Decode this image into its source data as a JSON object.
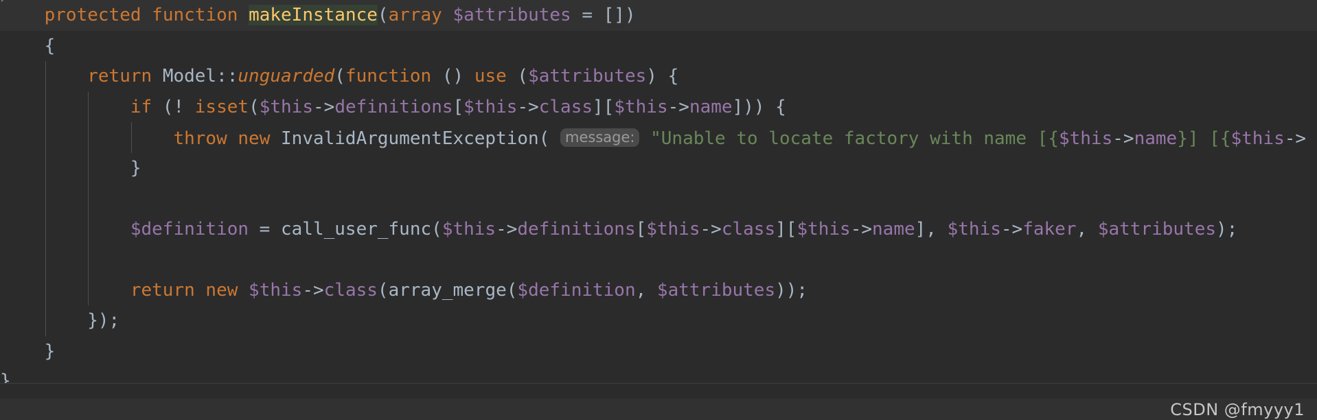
{
  "window": {
    "app": "code-editor",
    "theme": "darcula",
    "language": "PHP"
  },
  "colors": {
    "background": "#2b2b2b",
    "caret_line_background": "#323232",
    "default_text": "#a9b7c6",
    "keyword": "#cc7832",
    "function_declaration": "#ffc66d",
    "variable": "#9876aa",
    "string": "#6a8759",
    "inlay_hint_background": "#4a4a4a",
    "inlay_hint_text": "#9a9a9a",
    "identifier_highlight": "#344134",
    "indent_guide": "#4f5052",
    "watermark_text": "#c7c7c7"
  },
  "editor": {
    "fragment_above": "/",
    "fragment_below": "}",
    "lines": [
      {
        "id": "line-signature",
        "caret": true,
        "indent": 1,
        "tokens": [
          {
            "t": "    ",
            "c": "plain"
          },
          {
            "t": "protected",
            "c": "kw"
          },
          {
            "t": " ",
            "c": "plain"
          },
          {
            "t": "function",
            "c": "kw"
          },
          {
            "t": " ",
            "c": "plain"
          },
          {
            "t": "makeInstance",
            "c": "fn",
            "hl": true
          },
          {
            "t": "(",
            "c": "punc"
          },
          {
            "t": "array",
            "c": "kw"
          },
          {
            "t": " ",
            "c": "plain"
          },
          {
            "t": "$attributes",
            "c": "var"
          },
          {
            "t": " = [])",
            "c": "punc"
          }
        ]
      },
      {
        "id": "line-open-brace",
        "caret": false,
        "indent": 1,
        "tokens": [
          {
            "t": "    {",
            "c": "punc"
          }
        ]
      },
      {
        "id": "line-return-unguarded",
        "caret": false,
        "indent": 2,
        "tokens": [
          {
            "t": "        ",
            "c": "plain"
          },
          {
            "t": "return",
            "c": "kw"
          },
          {
            "t": " ",
            "c": "plain"
          },
          {
            "t": "Model",
            "c": "cls"
          },
          {
            "t": "::",
            "c": "punc"
          },
          {
            "t": "unguarded",
            "c": "kw-i"
          },
          {
            "t": "(",
            "c": "punc"
          },
          {
            "t": "function",
            "c": "kw"
          },
          {
            "t": " () ",
            "c": "punc"
          },
          {
            "t": "use",
            "c": "kw"
          },
          {
            "t": " (",
            "c": "punc"
          },
          {
            "t": "$attributes",
            "c": "var"
          },
          {
            "t": ") {",
            "c": "punc"
          }
        ]
      },
      {
        "id": "line-if-isset",
        "caret": false,
        "indent": 3,
        "tokens": [
          {
            "t": "            ",
            "c": "plain"
          },
          {
            "t": "if",
            "c": "kw"
          },
          {
            "t": " (! ",
            "c": "punc"
          },
          {
            "t": "isset",
            "c": "kw"
          },
          {
            "t": "(",
            "c": "punc"
          },
          {
            "t": "$this",
            "c": "var"
          },
          {
            "t": "->",
            "c": "punc"
          },
          {
            "t": "definitions",
            "c": "var"
          },
          {
            "t": "[",
            "c": "punc"
          },
          {
            "t": "$this",
            "c": "var"
          },
          {
            "t": "->",
            "c": "punc"
          },
          {
            "t": "class",
            "c": "var"
          },
          {
            "t": "][",
            "c": "punc"
          },
          {
            "t": "$this",
            "c": "var"
          },
          {
            "t": "->",
            "c": "punc"
          },
          {
            "t": "name",
            "c": "var"
          },
          {
            "t": "])) {",
            "c": "punc"
          }
        ]
      },
      {
        "id": "line-throw",
        "caret": false,
        "indent": 4,
        "tokens": [
          {
            "t": "                ",
            "c": "plain"
          },
          {
            "t": "throw",
            "c": "kw"
          },
          {
            "t": " ",
            "c": "plain"
          },
          {
            "t": "new",
            "c": "kw"
          },
          {
            "t": " ",
            "c": "plain"
          },
          {
            "t": "InvalidArgumentException",
            "c": "cls"
          },
          {
            "t": "(",
            "c": "punc"
          },
          {
            "t": " ",
            "c": "plain"
          },
          {
            "t": "message:",
            "c": "inlay"
          },
          {
            "t": " ",
            "c": "plain"
          },
          {
            "t": "\"Unable to locate factory with name [",
            "c": "str"
          },
          {
            "t": "{",
            "c": "str"
          },
          {
            "t": "$this",
            "c": "var"
          },
          {
            "t": "->",
            "c": "punc"
          },
          {
            "t": "name",
            "c": "var"
          },
          {
            "t": "}",
            "c": "str"
          },
          {
            "t": "] [",
            "c": "str"
          },
          {
            "t": "{",
            "c": "str"
          },
          {
            "t": "$this",
            "c": "var"
          },
          {
            "t": "->",
            "c": "punc"
          }
        ]
      },
      {
        "id": "line-close-if",
        "caret": false,
        "indent": 3,
        "tokens": [
          {
            "t": "            }",
            "c": "punc"
          }
        ]
      },
      {
        "id": "line-blank-1",
        "caret": false,
        "indent": 3,
        "tokens": [
          {
            "t": " ",
            "c": "plain"
          }
        ]
      },
      {
        "id": "line-definition",
        "caret": false,
        "indent": 3,
        "tokens": [
          {
            "t": "            ",
            "c": "plain"
          },
          {
            "t": "$definition",
            "c": "var"
          },
          {
            "t": " = ",
            "c": "punc"
          },
          {
            "t": "call_user_func",
            "c": "fncall"
          },
          {
            "t": "(",
            "c": "punc"
          },
          {
            "t": "$this",
            "c": "var"
          },
          {
            "t": "->",
            "c": "punc"
          },
          {
            "t": "definitions",
            "c": "var"
          },
          {
            "t": "[",
            "c": "punc"
          },
          {
            "t": "$this",
            "c": "var"
          },
          {
            "t": "->",
            "c": "punc"
          },
          {
            "t": "class",
            "c": "var"
          },
          {
            "t": "][",
            "c": "punc"
          },
          {
            "t": "$this",
            "c": "var"
          },
          {
            "t": "->",
            "c": "punc"
          },
          {
            "t": "name",
            "c": "var"
          },
          {
            "t": "], ",
            "c": "punc"
          },
          {
            "t": "$this",
            "c": "var"
          },
          {
            "t": "->",
            "c": "punc"
          },
          {
            "t": "faker",
            "c": "var"
          },
          {
            "t": ", ",
            "c": "punc"
          },
          {
            "t": "$attributes",
            "c": "var"
          },
          {
            "t": ");",
            "c": "punc"
          }
        ]
      },
      {
        "id": "line-blank-2",
        "caret": false,
        "indent": 3,
        "tokens": [
          {
            "t": " ",
            "c": "plain"
          }
        ]
      },
      {
        "id": "line-return-new",
        "caret": false,
        "indent": 3,
        "tokens": [
          {
            "t": "            ",
            "c": "plain"
          },
          {
            "t": "return",
            "c": "kw"
          },
          {
            "t": " ",
            "c": "plain"
          },
          {
            "t": "new",
            "c": "kw"
          },
          {
            "t": " ",
            "c": "plain"
          },
          {
            "t": "$this",
            "c": "var"
          },
          {
            "t": "->",
            "c": "punc"
          },
          {
            "t": "class",
            "c": "var"
          },
          {
            "t": "(",
            "c": "punc"
          },
          {
            "t": "array_merge",
            "c": "fncall"
          },
          {
            "t": "(",
            "c": "punc"
          },
          {
            "t": "$definition",
            "c": "var"
          },
          {
            "t": ", ",
            "c": "punc"
          },
          {
            "t": "$attributes",
            "c": "var"
          },
          {
            "t": "));",
            "c": "punc"
          }
        ]
      },
      {
        "id": "line-close-closure",
        "caret": false,
        "indent": 2,
        "tokens": [
          {
            "t": "        });",
            "c": "punc"
          }
        ]
      },
      {
        "id": "line-close-method",
        "caret": false,
        "indent": 1,
        "tokens": [
          {
            "t": "    }",
            "c": "punc"
          }
        ]
      }
    ]
  },
  "watermark": {
    "text": "CSDN @fmyyy1"
  }
}
